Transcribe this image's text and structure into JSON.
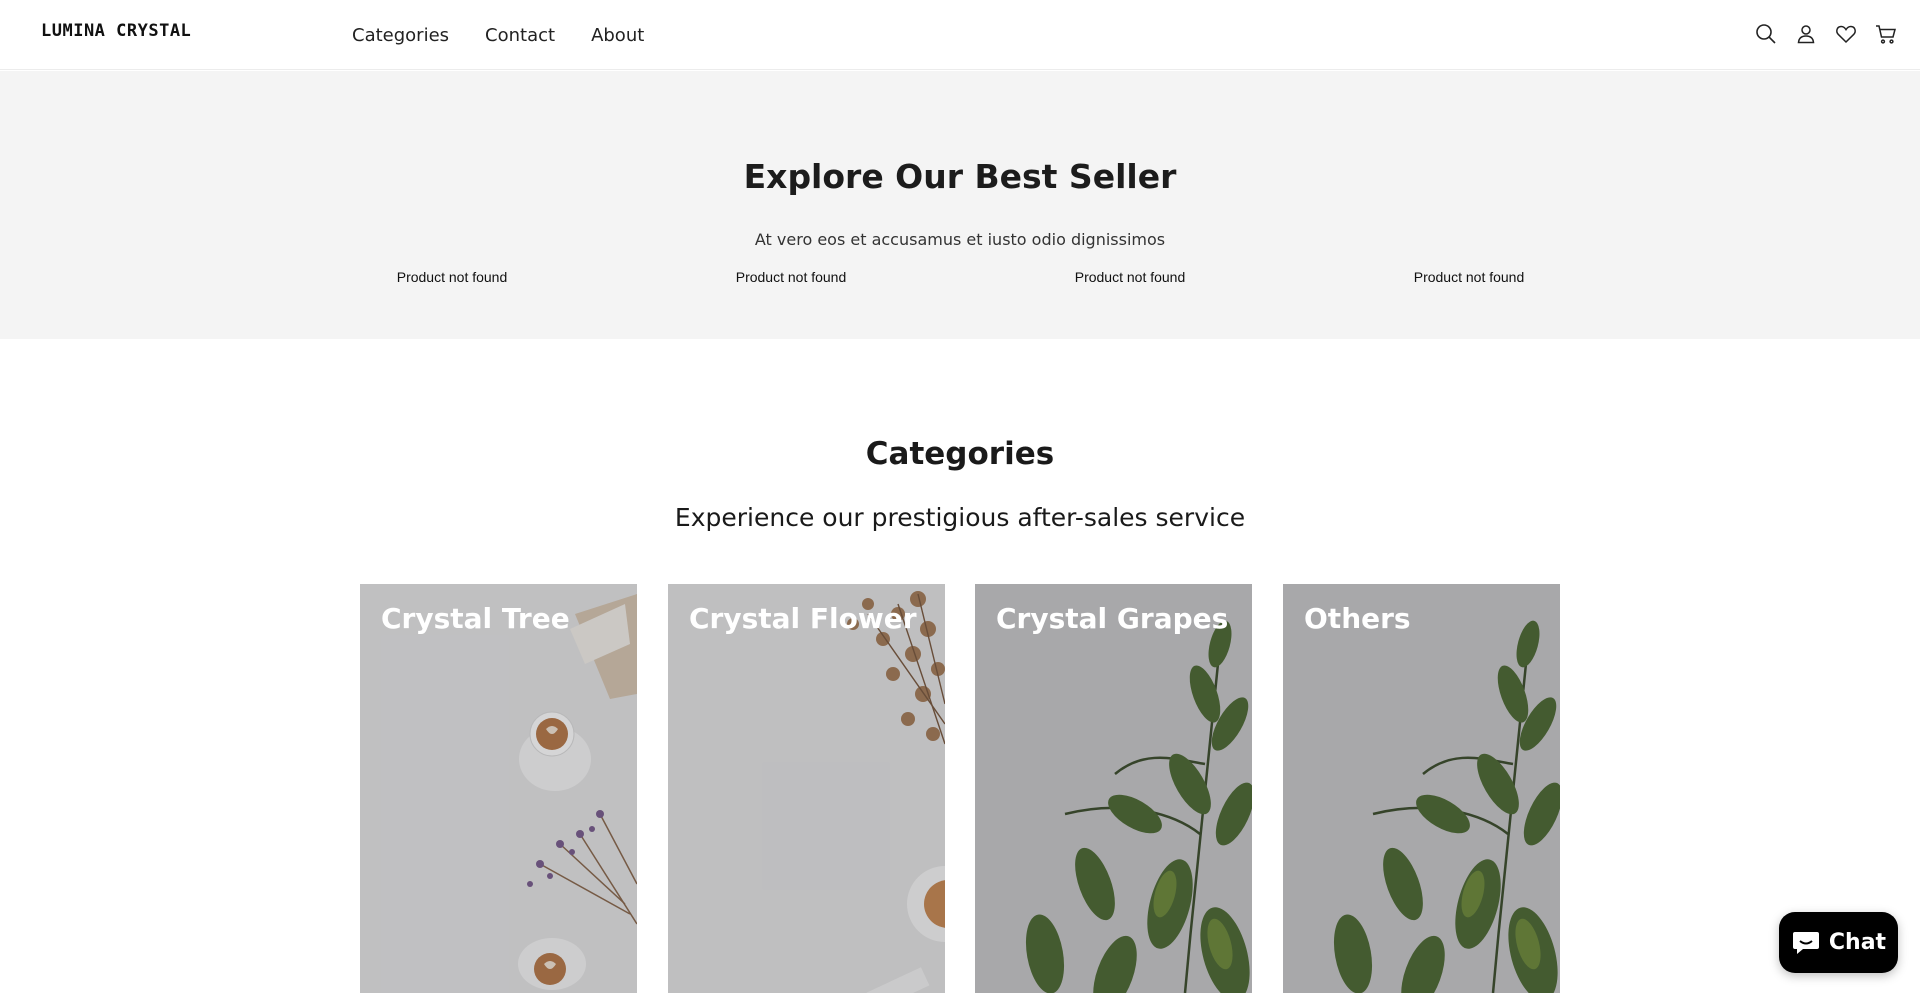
{
  "header": {
    "logo": "LUMINA CRYSTAL",
    "nav": [
      {
        "label": "Categories"
      },
      {
        "label": "Contact"
      },
      {
        "label": "About"
      }
    ],
    "icons": [
      "search-icon",
      "account-icon",
      "wishlist-icon",
      "cart-icon"
    ]
  },
  "bestseller": {
    "title": "Explore Our Best Seller",
    "subtitle": "At vero eos et accusamus et iusto odio dignissimos",
    "products": [
      {
        "status": "Product not found"
      },
      {
        "status": "Product not found"
      },
      {
        "status": "Product not found"
      },
      {
        "status": "Product not found"
      }
    ]
  },
  "categories": {
    "title": "Categories",
    "subtitle": "Experience our prestigious after-sales service",
    "items": [
      {
        "label": "Crystal Tree"
      },
      {
        "label": "Crystal Flower"
      },
      {
        "label": "Crystal Grapes"
      },
      {
        "label": "Others"
      }
    ]
  },
  "chat": {
    "label": "Chat"
  },
  "colors": {
    "band_background": "#f4f4f4",
    "card_background": "#bdbdbf",
    "chat_background": "#000000"
  }
}
